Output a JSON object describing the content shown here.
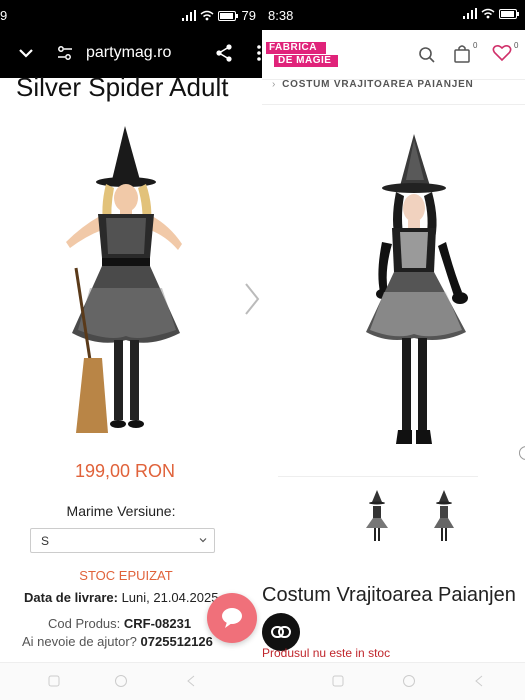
{
  "left": {
    "status": {
      "battery": "79"
    },
    "browser": {
      "url": "partymag.ro"
    },
    "product_title": "Silver Spider Adult",
    "price": "199,00 RON",
    "size_label": "Marime Versiune:",
    "size_value": "S",
    "stock_status": "STOC EPUIZAT",
    "delivery_label": "Data de livrare:",
    "delivery_value": "Luni, 21.04.2025",
    "code_label": "Cod Produs:",
    "code_value": "CRF-08231",
    "help_label": "Ai nevoie de ajutor?",
    "help_phone": "0725512126"
  },
  "right": {
    "status": {
      "time": "8:38"
    },
    "logo_text_top": "FABRICA",
    "logo_text_bottom": "DE MAGIE",
    "cart_count": "0",
    "wishlist_count": "0",
    "breadcrumb": "COSTUM VRAJITOAREA PAIANJEN",
    "product_title": "Costum Vrajitoarea Paianjen",
    "stock_message": "Produsul nu este in stoc"
  },
  "colors": {
    "price": "#e0623a",
    "stock_red": "#c0262c",
    "chat": "#f0707a",
    "logo": "#e0237a"
  }
}
